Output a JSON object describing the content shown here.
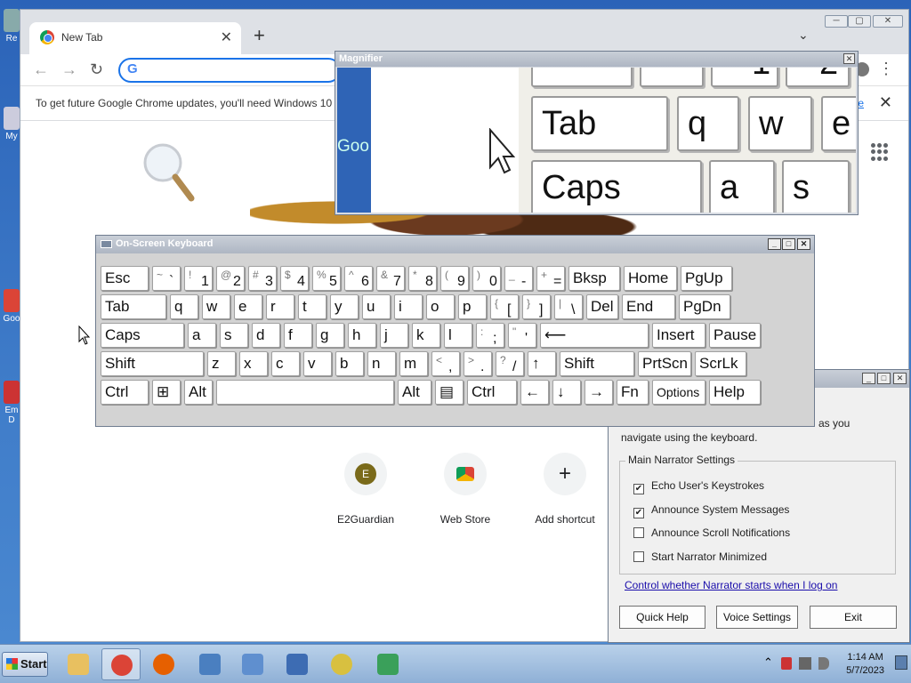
{
  "chrome": {
    "tab_title": "New Tab",
    "tab_close": "✕",
    "new_tab": "+",
    "tab_menu": "⌄",
    "win_min": "─",
    "win_max": "▢",
    "win_close": "✕",
    "back": "←",
    "forward": "→",
    "reload": "↻",
    "omnibox_g": "G",
    "menu": "⋮",
    "infobar_message": "To get future Google Chrome updates, you'll need Windows 10",
    "infobar_link": "e",
    "infobar_close": "✕"
  },
  "shortcuts": [
    {
      "label": "E2Guardian",
      "icon_text": "E"
    },
    {
      "label": "Web Store",
      "icon_text": ""
    },
    {
      "label": "Add shortcut",
      "icon_text": "+"
    }
  ],
  "desktop": {
    "icons": [
      "Re",
      "My",
      "Goo",
      "Em\nD"
    ]
  },
  "magnifier": {
    "title": "Magnifier",
    "close": "✕",
    "left_fragment": "Goo",
    "keys": {
      "tab": "Tab",
      "q": "q",
      "w": "w",
      "e": "e",
      "caps": "Caps",
      "a": "a",
      "s": "s",
      "top1": "1",
      "top2": "2"
    }
  },
  "osk": {
    "title": "On-Screen Keyboard",
    "btn_min": "_",
    "btn_max": "□",
    "btn_close": "✕",
    "rows": [
      [
        [
          "Esc",
          ""
        ],
        [
          "`",
          "~"
        ],
        [
          "1",
          "!"
        ],
        [
          "2",
          "@"
        ],
        [
          "3",
          "#"
        ],
        [
          "4",
          "$"
        ],
        [
          "5",
          "%"
        ],
        [
          "6",
          "^"
        ],
        [
          "7",
          "&"
        ],
        [
          "8",
          "*"
        ],
        [
          "9",
          "("
        ],
        [
          "0",
          ")"
        ],
        [
          "-",
          "_"
        ],
        [
          "=",
          "+"
        ],
        [
          "Bksp",
          ""
        ],
        [
          "Home",
          ""
        ],
        [
          "PgUp",
          ""
        ]
      ],
      [
        [
          "Tab",
          ""
        ],
        [
          "q",
          ""
        ],
        [
          "w",
          ""
        ],
        [
          "e",
          ""
        ],
        [
          "r",
          ""
        ],
        [
          "t",
          ""
        ],
        [
          "y",
          ""
        ],
        [
          "u",
          ""
        ],
        [
          "i",
          ""
        ],
        [
          "o",
          ""
        ],
        [
          "p",
          ""
        ],
        [
          "[",
          "{"
        ],
        [
          "]",
          "}"
        ],
        [
          "\\",
          "|"
        ],
        [
          "Del",
          ""
        ],
        [
          "End",
          ""
        ],
        [
          "PgDn",
          ""
        ]
      ],
      [
        [
          "Caps",
          ""
        ],
        [
          "a",
          ""
        ],
        [
          "s",
          ""
        ],
        [
          "d",
          ""
        ],
        [
          "f",
          ""
        ],
        [
          "g",
          ""
        ],
        [
          "h",
          ""
        ],
        [
          "j",
          ""
        ],
        [
          "k",
          ""
        ],
        [
          "l",
          ""
        ],
        [
          ";",
          ":"
        ],
        [
          "'",
          "\""
        ],
        [
          "⟵",
          ""
        ],
        [
          "Insert",
          ""
        ],
        [
          "Pause",
          ""
        ]
      ],
      [
        [
          "Shift",
          ""
        ],
        [
          "z",
          ""
        ],
        [
          "x",
          ""
        ],
        [
          "c",
          ""
        ],
        [
          "v",
          ""
        ],
        [
          "b",
          ""
        ],
        [
          "n",
          ""
        ],
        [
          "m",
          ""
        ],
        [
          ",",
          "<"
        ],
        [
          ".",
          ">"
        ],
        [
          "/",
          "?"
        ],
        [
          "↑",
          ""
        ],
        [
          "Shift",
          ""
        ],
        [
          "PrtScn",
          ""
        ],
        [
          "ScrLk",
          ""
        ]
      ],
      [
        [
          "Ctrl",
          ""
        ],
        [
          "⊞",
          ""
        ],
        [
          "Alt",
          ""
        ],
        [
          "",
          ""
        ],
        [
          "Alt",
          ""
        ],
        [
          "▤",
          ""
        ],
        [
          "Ctrl",
          ""
        ],
        [
          "←",
          ""
        ],
        [
          "↓",
          ""
        ],
        [
          "→",
          ""
        ],
        [
          "Fn",
          ""
        ],
        [
          "Options",
          ""
        ],
        [
          "Help",
          ""
        ]
      ]
    ]
  },
  "narrator": {
    "description_fragment": "as you",
    "description_line2": "navigate using the keyboard.",
    "group_title": "Main Narrator Settings",
    "checkboxes": [
      {
        "label": "Echo User's Keystrokes",
        "checked": "✔"
      },
      {
        "label": "Announce System Messages",
        "checked": "✔"
      },
      {
        "label": "Announce Scroll Notifications",
        "checked": ""
      },
      {
        "label": "Start Narrator Minimized",
        "checked": ""
      }
    ],
    "link": "Control whether Narrator starts when I log on",
    "buttons": {
      "quick_help": "Quick Help",
      "voice_settings": "Voice Settings",
      "exit": "Exit"
    },
    "win_min": "_",
    "win_max": "□",
    "win_close": "✕"
  },
  "taskbar": {
    "start": "Start",
    "time": "1:14 AM",
    "date": "5/7/2023",
    "tray_chevron": "⌃",
    "colors": {
      "explorer": "#e8c060",
      "chrome": "#db4437",
      "firefox": "#e66000",
      "network": "#4a7fc0",
      "magnifier": "#5f8fcf",
      "osk": "#3d6cb3",
      "narrator": "#d8c040",
      "download": "#3aa05a"
    }
  }
}
